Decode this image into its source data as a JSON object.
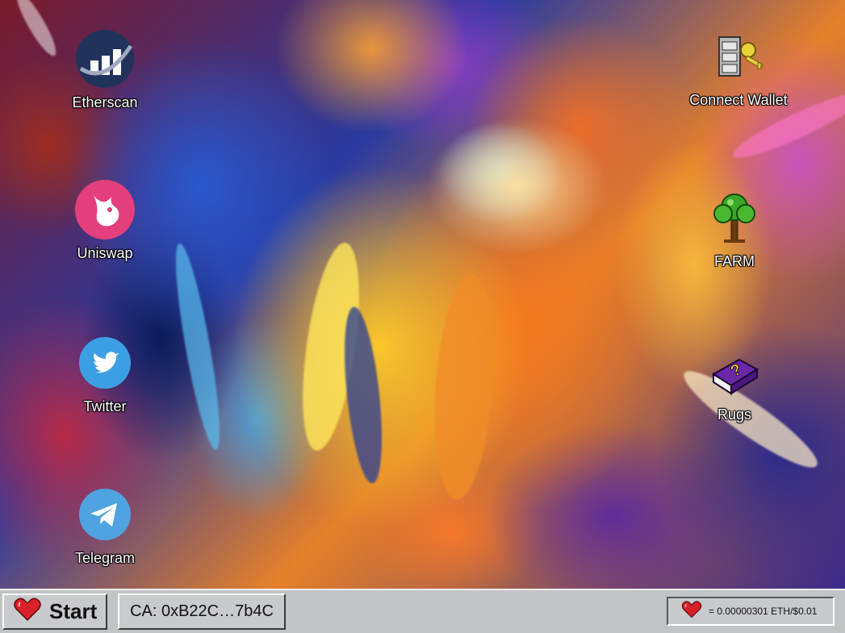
{
  "desktop": {
    "icons_left": [
      {
        "id": "etherscan",
        "label": "Etherscan",
        "icon": "etherscan-logo"
      },
      {
        "id": "uniswap",
        "label": "Uniswap",
        "icon": "uniswap-unicorn"
      },
      {
        "id": "twitter",
        "label": "Twitter",
        "icon": "twitter-bird"
      },
      {
        "id": "telegram",
        "label": "Telegram",
        "icon": "telegram-paper-plane"
      }
    ],
    "icons_right": [
      {
        "id": "connect-wallet",
        "label": "Connect Wallet",
        "icon": "keys-cabinet"
      },
      {
        "id": "farm",
        "label": "FARM",
        "icon": "tree"
      },
      {
        "id": "rugs",
        "label": "Rugs",
        "icon": "help-book"
      }
    ]
  },
  "taskbar": {
    "start_label": "Start",
    "contract_label": "CA: 0xB22C…7b4C",
    "price_text": "= 0.00000301 ETH/$0.01"
  },
  "colors": {
    "taskbar_bg": "#c2c3c7",
    "heart_red": "#d8202a",
    "uniswap_pink": "#e43f7d",
    "twitter_blue": "#3d9fe3",
    "telegram_blue": "#4ea3e0"
  }
}
